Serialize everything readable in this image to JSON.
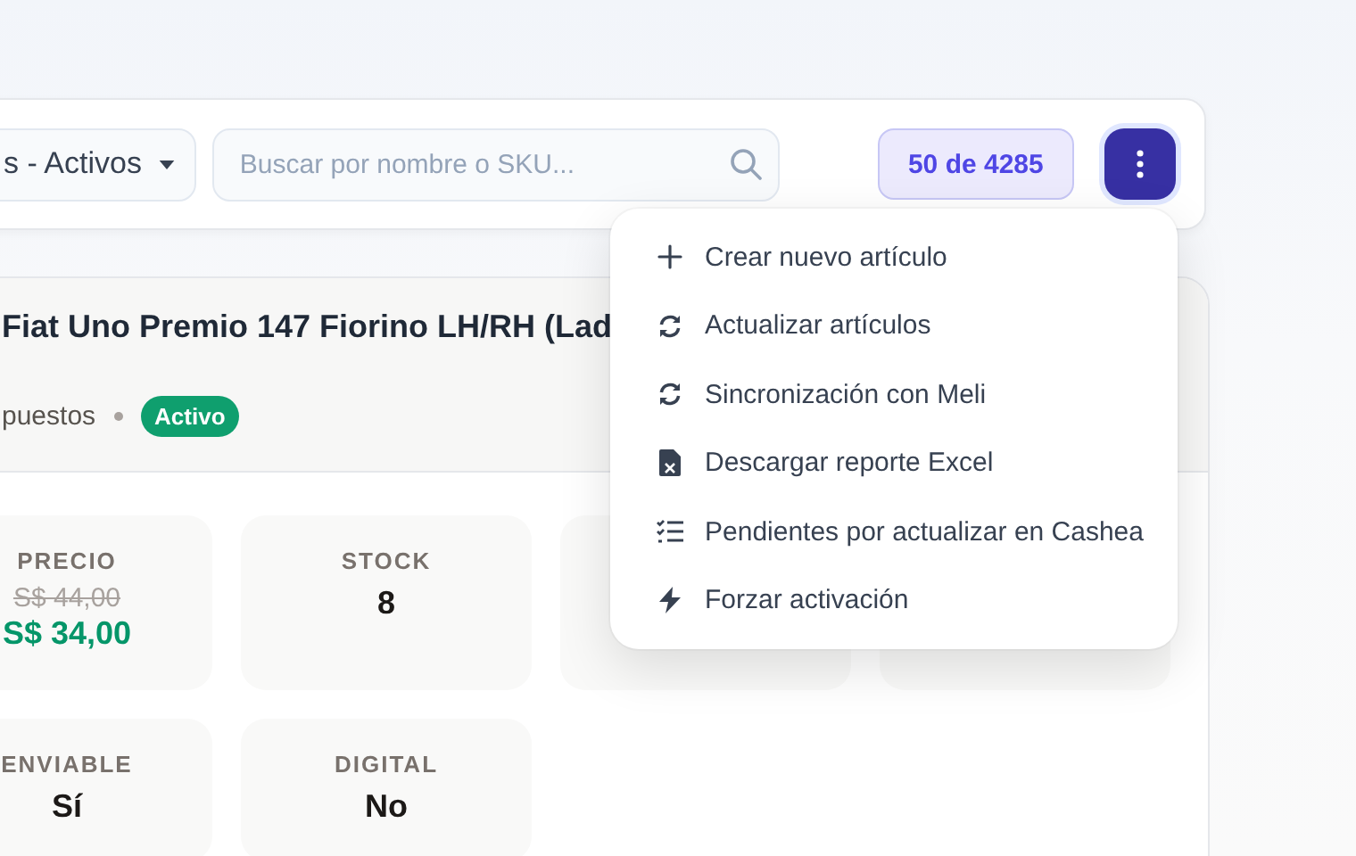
{
  "toolbar": {
    "filter": {
      "value": "s - Activos"
    },
    "search": {
      "placeholder": "Buscar por nombre o SKU..."
    },
    "count": "50 de 4285"
  },
  "menu": {
    "open": true,
    "items": [
      {
        "kind": "plus",
        "label": "Crear nuevo artículo"
      },
      {
        "kind": "sync",
        "label": "Actualizar artículos"
      },
      {
        "kind": "sync",
        "label": "Sincronización con Meli"
      },
      {
        "kind": "excel",
        "label": "Descargar reporte Excel"
      },
      {
        "kind": "checklist",
        "label": "Pendientes por actualizar en Cashea"
      },
      {
        "kind": "bolt",
        "label": "Forzar activación"
      }
    ]
  },
  "product": {
    "title": "Fiat Uno Premio 147 Fiorino LH/RH (Lad",
    "category": "puestos",
    "status": "Activo",
    "stats": [
      {
        "label": "PRECIO",
        "old_value": "S$ 44,00",
        "value": "S$ 34,00"
      },
      {
        "label": "STOCK",
        "value": "8"
      },
      {
        "label": "ENVIABLE",
        "value": "Sí"
      },
      {
        "label": "DIGITAL",
        "value": "No"
      }
    ]
  }
}
